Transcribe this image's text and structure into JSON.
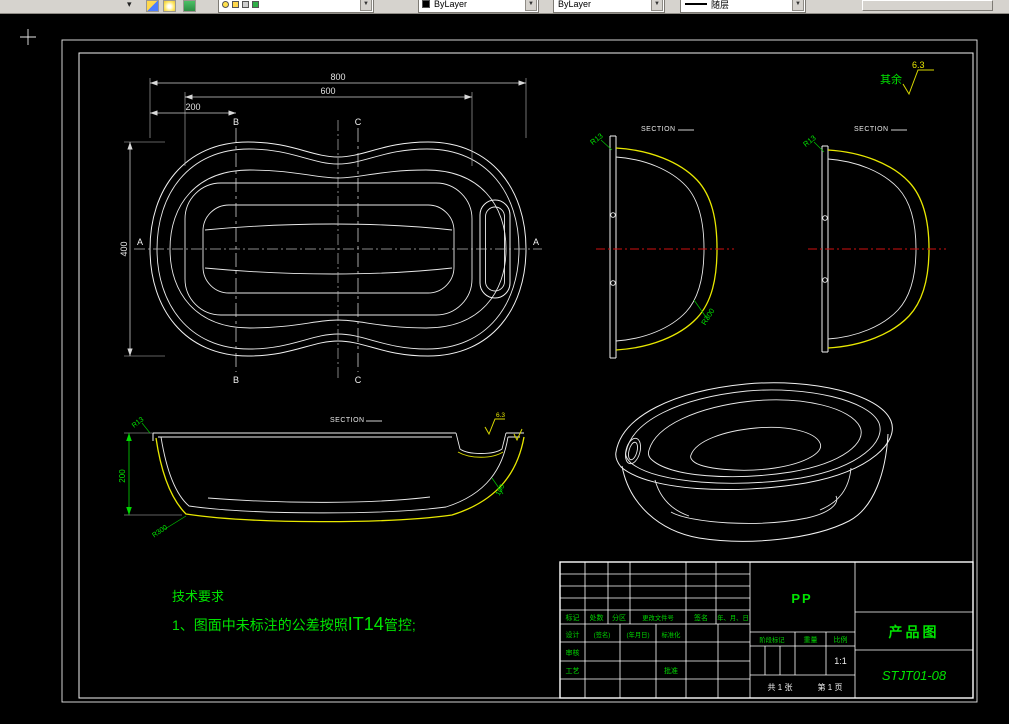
{
  "toolbar": {
    "color_value": "ByLayer",
    "linetype_value": "ByLayer",
    "lineweight_value": "随层"
  },
  "notes": {
    "surplus": "其余",
    "roughness": "6.3",
    "tech_title": "技术要求",
    "tech_item_prefix": "1、图面中未标注的公差按照",
    "tech_item_code": "IT14",
    "tech_item_suffix": "管控;"
  },
  "plan": {
    "dim_width": "800",
    "dim_inner": "600",
    "dim_offset": "200",
    "dim_height": "400",
    "marker_a": "A",
    "marker_b": "B",
    "marker_c": "C"
  },
  "sections": {
    "label": "SECTION",
    "r13": "R13",
    "r300": "R300",
    "r100": "100",
    "depth": "200"
  },
  "titleblock": {
    "material": "PP",
    "title": "产品图",
    "number": "STJT01-08",
    "scale_value": "1:1",
    "sheet_total": "共 1 张",
    "sheet_page": "第 1 页",
    "labels": {
      "mark": "标记",
      "count": "处数",
      "zone": "分区",
      "file": "更改文件号",
      "sign": "签名",
      "date": "年、月、日",
      "design": "设计",
      "sign2": "(签名)",
      "date2": "(年月日)",
      "standard": "标准化",
      "review": "审核",
      "craft": "工艺",
      "approve": "批准",
      "stage": "阶段标记",
      "weight": "重量",
      "scale": "比例"
    }
  }
}
